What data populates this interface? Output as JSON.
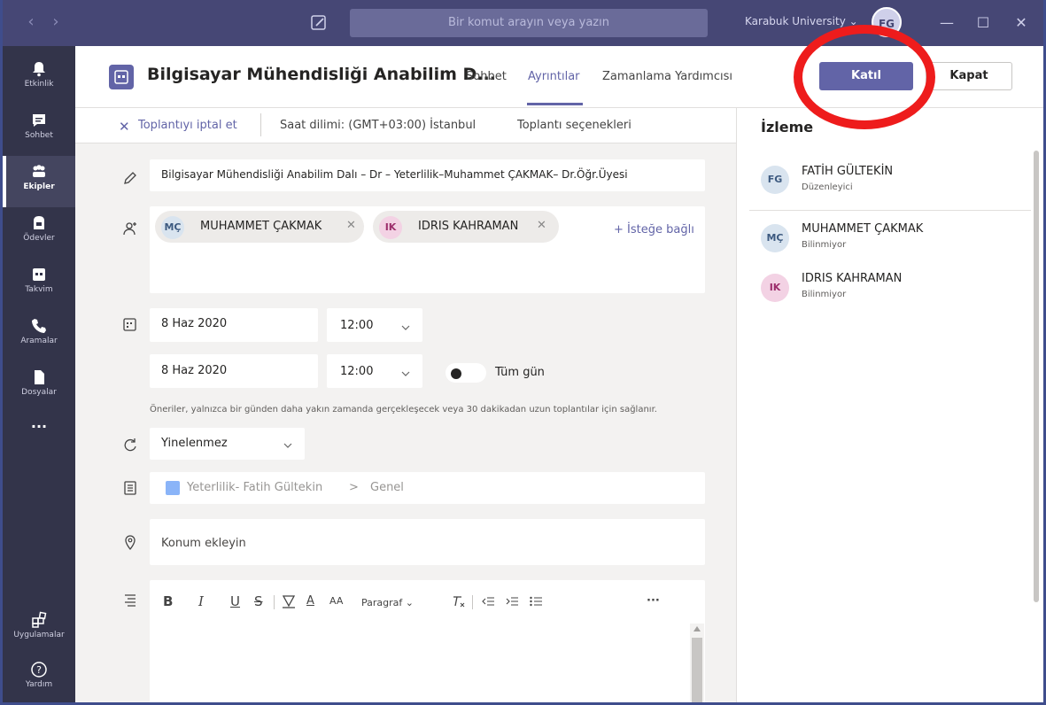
{
  "titlebar": {
    "search_placeholder": "Bir komut arayın veya yazın",
    "org_name": "Karabuk University",
    "user_initials": "FG"
  },
  "rail": {
    "items": [
      {
        "label": "Etkinlik",
        "icon": "bell-icon"
      },
      {
        "label": "Sohbet",
        "icon": "chat-icon"
      },
      {
        "label": "Ekipler",
        "icon": "teams-icon",
        "active": true
      },
      {
        "label": "Ödevler",
        "icon": "assignments-icon"
      },
      {
        "label": "Takvim",
        "icon": "calendar-icon"
      },
      {
        "label": "Aramalar",
        "icon": "phone-icon"
      },
      {
        "label": "Dosyalar",
        "icon": "files-icon"
      }
    ],
    "more": "...",
    "apps_label": "Uygulamalar",
    "help_label": "Yardım"
  },
  "header": {
    "title": "Bilgisayar Mühendisliği Anabilim D...",
    "tabs": [
      {
        "label": "Sohbet"
      },
      {
        "label": "Ayrıntılar",
        "active": true
      },
      {
        "label": "Zamanlama Yardımcısı"
      }
    ],
    "join_label": "Katıl",
    "close_label": "Kapat"
  },
  "toolbar": {
    "cancel_label": "Toplantıyı iptal et",
    "timezone_label": "Saat dilimi: (GMT+03:00) İstanbul",
    "options_label": "Toplantı seçenekleri"
  },
  "form": {
    "title_value": "Bilgisayar Mühendisliği Anabilim Dalı – Dr – Yeterlilik–Muhammet ÇAKMAK– Dr.Öğr.Üyesi",
    "attendees": [
      {
        "initials": "MÇ",
        "name": "MUHAMMET ÇAKMAK"
      },
      {
        "initials": "IK",
        "name": "IDRIS KAHRAMAN"
      }
    ],
    "optional_link": "+ İsteğe bağlı",
    "start_date": "8 Haz 2020",
    "start_time": "12:00",
    "end_date": "8 Haz 2020",
    "end_time": "12:00",
    "all_day_label": "Tüm gün",
    "hint": "Öneriler, yalnızca bir günden daha yakın zamanda gerçekleşecek veya 30 dakikadan uzun toplantılar için sağlanır.",
    "repeat_value": "Yinelenmez",
    "channel_team": "Yeterlilik- Fatih Gültekin",
    "channel_sep": ">",
    "channel_name": "Genel",
    "location_placeholder": "Konum ekleyin",
    "rte": {
      "bold": "B",
      "italic": "I",
      "underline": "U",
      "strike": "S",
      "font_color": "A",
      "font_size": "AA",
      "paragraph": "Paragraf",
      "more": "···"
    }
  },
  "tracking": {
    "title": "İzleme",
    "people": [
      {
        "initials": "FG",
        "name": "FATİH GÜLTEKİN",
        "role": "Düzenleyici"
      },
      {
        "initials": "MÇ",
        "name": "MUHAMMET ÇAKMAK",
        "role": "Bilinmiyor"
      },
      {
        "initials": "IK",
        "name": "IDRIS KAHRAMAN",
        "role": "Bilinmiyor"
      }
    ]
  },
  "colors": {
    "accent": "#6264a7",
    "titlebar": "#464775",
    "rail": "#33344a",
    "annotation": "#ee1c1c"
  }
}
